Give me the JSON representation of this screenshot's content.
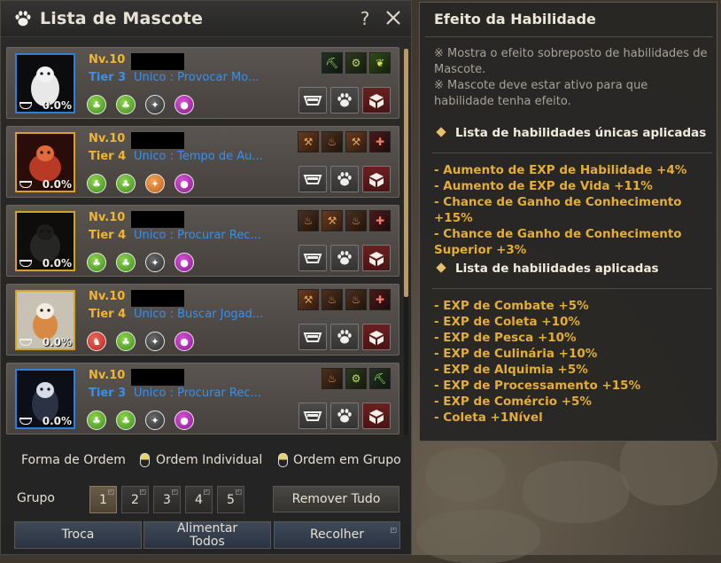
{
  "panel": {
    "title": "Lista de Mascote",
    "help": "?",
    "colors": {
      "tier3": "#3b8fe8",
      "tier4": "#f2b531",
      "highlight": "#e3ad36"
    }
  },
  "pets": [
    {
      "level": "Nv.10",
      "tier": "Tier 3",
      "special": "Único : Provocar Mo...",
      "hunger": "0.0%",
      "frame": "blue",
      "traits": [
        "green",
        "green",
        "gray",
        "purple"
      ],
      "skills": [
        "pick",
        "gear",
        "leaf"
      ]
    },
    {
      "level": "Nv.10",
      "tier": "Tier 4",
      "special": "Único : Tempo de Au...",
      "hunger": "0.0%",
      "frame": "gold",
      "traits": [
        "green",
        "green",
        "orange",
        "purple"
      ],
      "skills": [
        "hammer",
        "brown",
        "hammer",
        "red"
      ]
    },
    {
      "level": "Nv.10",
      "tier": "Tier 4",
      "special": "Único : Procurar Rec...",
      "hunger": "0.0%",
      "frame": "gold",
      "traits": [
        "green",
        "green",
        "gray",
        "purple"
      ],
      "skills": [
        "brown",
        "hammer",
        "brown",
        "red"
      ]
    },
    {
      "level": "Nv.10",
      "tier": "Tier 4",
      "special": "Único : Buscar Jogad...",
      "hunger": "0.0%",
      "frame": "gold",
      "traits": [
        "red",
        "green",
        "gray",
        "purple"
      ],
      "skills": [
        "hammer",
        "brown",
        "brown",
        "red"
      ]
    },
    {
      "level": "Nv.10",
      "tier": "Tier 3",
      "special": "Único : Procurar Rec...",
      "hunger": "0.0%",
      "frame": "blue",
      "traits": [
        "green",
        "green",
        "gray",
        "purple"
      ],
      "skills": [
        "brown",
        "gear",
        "pick"
      ]
    }
  ],
  "sort": {
    "label": "Forma de Ordem",
    "individual": "Ordem Individual",
    "group": "Ordem em Grupo"
  },
  "group": {
    "label": "Grupo",
    "buttons": [
      "1",
      "2",
      "3",
      "4",
      "5"
    ],
    "active": "1",
    "remove_all": "Remover Tudo"
  },
  "bottom": {
    "swap": "Troca",
    "feed_all": "Alimentar Todos",
    "collect": "Recolher"
  },
  "tooltip": {
    "title": "Efeito da Habilidade",
    "note1": "※ Mostra o efeito sobreposto de habilidades de Mascote.",
    "note2": "※ Mascote deve estar ativo para que habilidade tenha efeito.",
    "unique_header": "Lista de habilidades únicas aplicadas",
    "unique_list": [
      "- Aumento de EXP de Habilidade +4%",
      "- Aumento de EXP de Vida +11%",
      "- Chance de Ganho de Conhecimento +15%",
      "- Chance de Ganho de Conhecimento Superior +3%"
    ],
    "skills_header": "Lista de habilidades aplicadas",
    "skills_list": [
      "- EXP de Combate +5%",
      "- EXP de Coleta +10%",
      "- EXP de Pesca +10%",
      "- EXP de Culinária +10%",
      "- EXP de Alquimia +5%",
      "- EXP de Processamento +15%",
      "- EXP de Comércio +5%",
      "- Coleta +1Nível"
    ]
  }
}
